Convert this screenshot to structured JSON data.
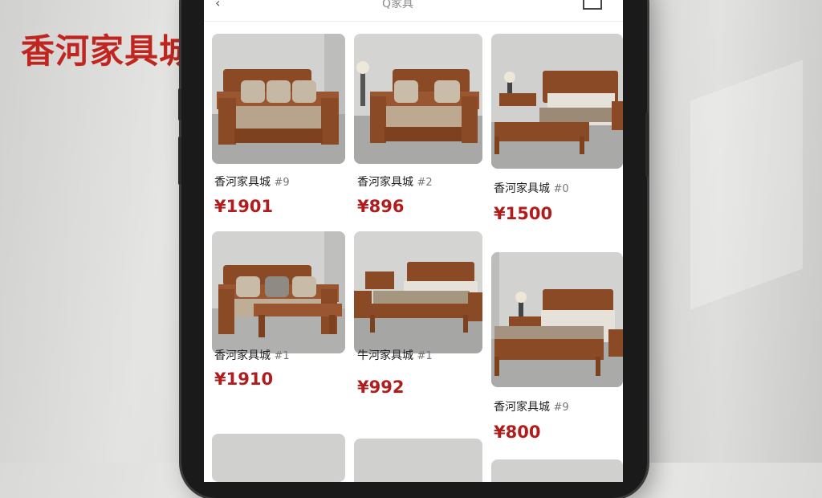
{
  "brand": "香河家具城",
  "topbar": {
    "back": "‹",
    "search": "Q家具"
  },
  "products": [
    {
      "title": "香河家具城",
      "sku": "#9",
      "price": "¥1901",
      "kind": "sofa"
    },
    {
      "title": "香河家具城",
      "sku": "#2",
      "price": "¥896",
      "kind": "sofa"
    },
    {
      "title": "香河家具城",
      "sku": "#0",
      "price": "¥1500",
      "kind": "bed"
    },
    {
      "title": "香河家具城",
      "sku": "#1",
      "price": "¥1910",
      "kind": "sofa-table"
    },
    {
      "title": "牛河家具城",
      "sku": "#1",
      "price": "¥992",
      "kind": "bed"
    },
    {
      "title": "香河家具城",
      "sku": "#9",
      "price": "¥800",
      "kind": "bed"
    }
  ],
  "colors": {
    "accent": "#c0261f",
    "price": "#b11d1d",
    "wood": "#8b4a26"
  }
}
